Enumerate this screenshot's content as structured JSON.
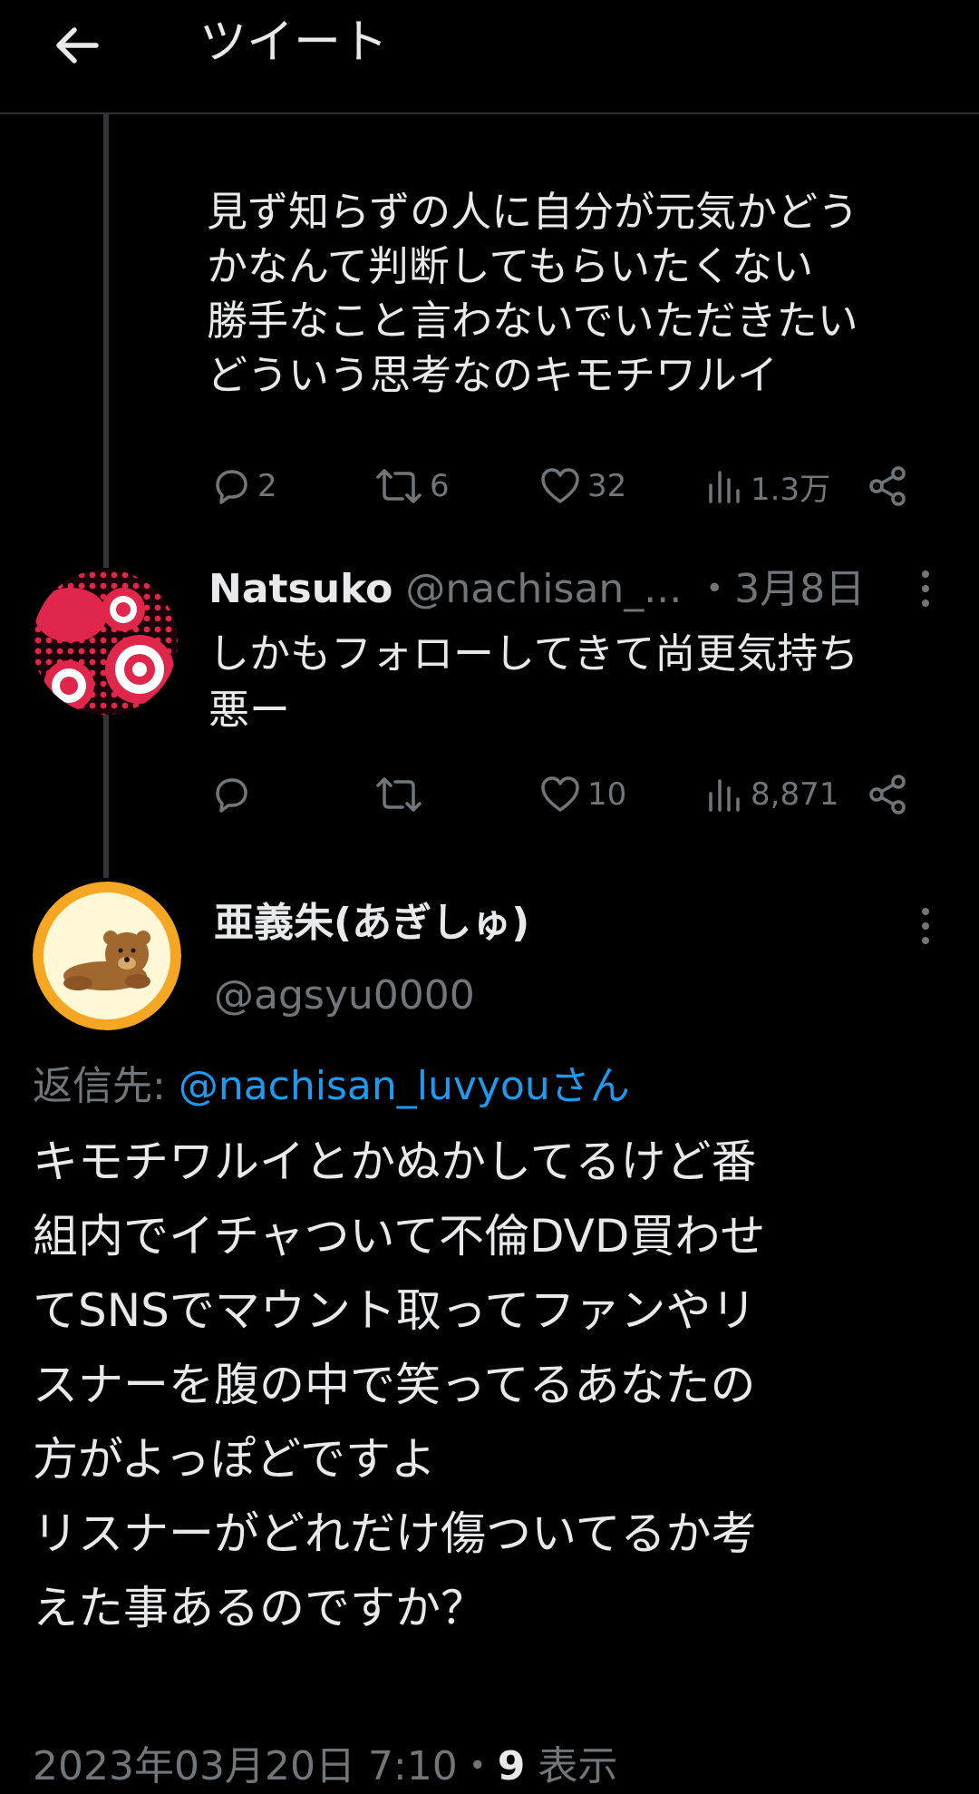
{
  "header": {
    "title": "ツイート"
  },
  "tweet1": {
    "text": "見ず知らずの人に自分が元気かどう\nかなんて判断してもらいたくない\n勝手なこと言わないでいただきたい\nどういう思考なのキモチワルイ",
    "stats": {
      "replies": "2",
      "retweets": "6",
      "likes": "32",
      "views": "1.3万"
    }
  },
  "tweet2": {
    "name": "Natsuko",
    "handle": "@nachisan_...",
    "date": "・3月8日",
    "text": "しかもフォローしてきて尚更気持ち\n悪ー",
    "stats": {
      "replies": "",
      "retweets": "",
      "likes": "10",
      "views": "8,871"
    }
  },
  "main": {
    "name": "亜義朱(あぎしゅ)",
    "handle": "@agsyu0000",
    "reply_prefix": "返信先: ",
    "reply_to": "@nachisan_luvyouさん",
    "text": "キモチワルイとかぬかしてるけど番\n組内でイチャついて不倫DVD買わせ\nてSNSでマウント取ってファンやリ\nスナーを腹の中で笑ってるあなたの\n方がよっぽどですよ\nリスナーがどれだけ傷ついてるか考\nえた事あるのですか？",
    "timestamp": "2023年03月20日 7:10・",
    "views_count": "9",
    "views_label": " 表示"
  },
  "colors": {
    "background": "#000000",
    "text": "#e7e9ea",
    "secondary": "#71767b",
    "link": "#1d9bf0",
    "divider": "#2f3336"
  }
}
